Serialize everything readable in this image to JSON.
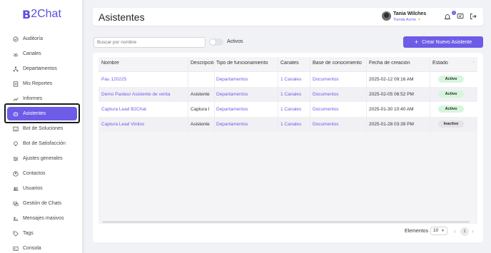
{
  "brand": {
    "logo_b": "B",
    "logo_text": "2Chat",
    "accent": "#6c5ce7"
  },
  "sidebar": {
    "items": [
      {
        "label": "Auditoría",
        "icon": "check-circle-icon"
      },
      {
        "label": "Canales",
        "icon": "broadcast-icon"
      },
      {
        "label": "Departamentos",
        "icon": "hierarchy-icon"
      },
      {
        "label": "Mis Reportes",
        "icon": "report-icon"
      },
      {
        "label": "Informes",
        "icon": "trend-icon"
      },
      {
        "label": "Asistentes",
        "icon": "robot-icon",
        "active": true
      },
      {
        "label": "Bot de Soluciones",
        "icon": "bot-icon"
      },
      {
        "label": "Bot de Satisfacción",
        "icon": "lightbulb-icon"
      },
      {
        "label": "Ajustes generales",
        "icon": "sliders-icon"
      },
      {
        "label": "Contactos",
        "icon": "contact-icon"
      },
      {
        "label": "Usuarios",
        "icon": "users-icon"
      },
      {
        "label": "Gestión de Chats",
        "icon": "chats-icon"
      },
      {
        "label": "Mensajes masivos",
        "icon": "bulk-message-icon"
      },
      {
        "label": "Tags",
        "icon": "tag-icon"
      },
      {
        "label": "Consola",
        "icon": "console-icon"
      }
    ]
  },
  "header": {
    "title": "Asistentes",
    "user_name": "Tania Wilches",
    "user_store": "Tienda Acme 🔸",
    "notification_count": "1"
  },
  "toolbar": {
    "search_placeholder": "Buscar por nombre",
    "toggle_label": "Activos",
    "create_label": "Crear Nuevo Asistente"
  },
  "table": {
    "columns": [
      "Nombre",
      "Descripción",
      "Tipo de funcionamiento",
      "Canales",
      "Base de conocimiento",
      "Fecha de creación",
      "Estado"
    ],
    "rows": [
      {
        "name": "Pau 120225",
        "description": "",
        "type": "Departamentos",
        "channels": "1 Canales",
        "kb": "Documentos",
        "date": "2025-02-12 09:16 AM",
        "status": "Activo",
        "active": true
      },
      {
        "name": "Demo Pasteur Asistente de venta",
        "description": "Asistente",
        "type": "Departamentos",
        "channels": "1 Canales",
        "kb": "Documentos",
        "date": "2025-02-05 06:52 PM",
        "status": "Activo",
        "active": true
      },
      {
        "name": "Captura Lead B2Chat",
        "description": "Captura l",
        "type": "Departamentos",
        "channels": "1 Canales",
        "kb": "Documentos",
        "date": "2025-01-30 10:40 AM",
        "status": "Activo",
        "active": true
      },
      {
        "name": "Captura Lead Vinilos",
        "description": "Asistente",
        "type": "Departamentos",
        "channels": "1 Canales",
        "kb": "Documentos",
        "date": "2025-01-28 03:39 PM",
        "status": "Inactivo",
        "active": false
      }
    ]
  },
  "footer": {
    "elements_label": "Elementos",
    "page_size": "10",
    "current_page": "1"
  }
}
